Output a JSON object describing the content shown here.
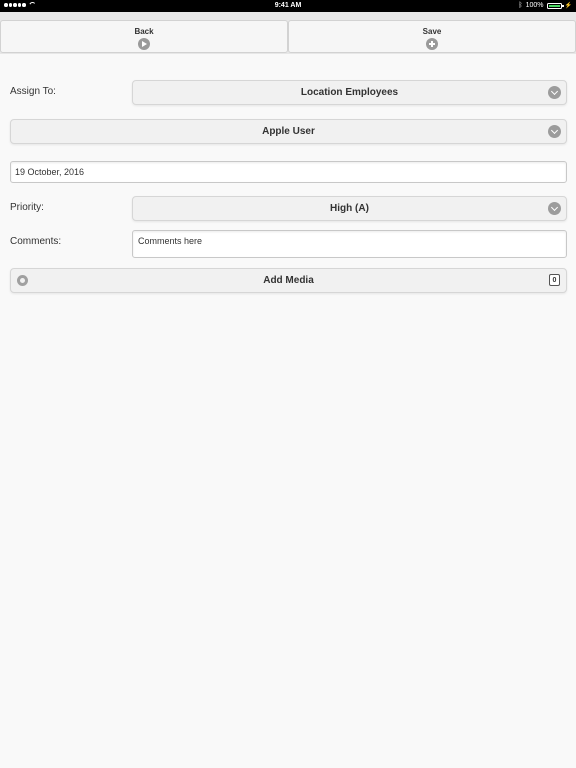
{
  "status_bar": {
    "time": "9:41 AM",
    "battery": "100%",
    "icons": {
      "signal": "signal-dots-icon",
      "wifi": "wifi-icon",
      "bluetooth": "bluetooth-icon",
      "battery": "battery-icon",
      "charging": "charging-icon"
    }
  },
  "toolbar": {
    "back_label": "Back",
    "save_label": "Save",
    "back_icon": "arrow-right-circle-icon",
    "save_icon": "plus-circle-icon"
  },
  "form": {
    "assign_to": {
      "label": "Assign To:",
      "value": "Location Employees"
    },
    "user": {
      "value": "Apple User"
    },
    "date": {
      "value": "19 October, 2016"
    },
    "priority": {
      "label": "Priority:",
      "value": "High (A)"
    },
    "comments": {
      "label": "Comments:",
      "value": "Comments here"
    },
    "add_media": {
      "label": "Add Media",
      "count": "0"
    }
  },
  "colors": {
    "status_bar": "#000000",
    "toolbar": "#e7e7e7",
    "background": "#f9f9f9",
    "button": "#f1f1f1",
    "icon_gray": "#9c9c9c",
    "battery": "#4cd964"
  }
}
